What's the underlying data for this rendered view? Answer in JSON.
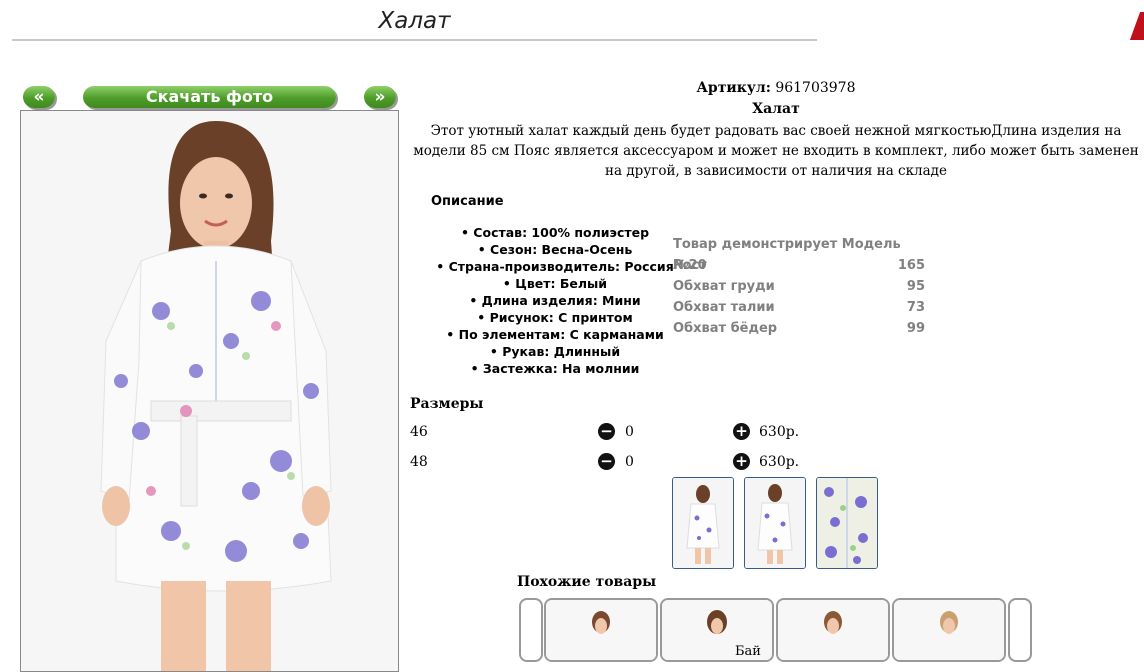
{
  "page": {
    "title": "Халат",
    "bottom_fragment": "Бай"
  },
  "nav": {
    "prev_label": "«",
    "download_label": "Скачать фото",
    "next_label": "»"
  },
  "product": {
    "article_label": "Артикул:",
    "article_value": "961703978",
    "name": "Халат",
    "description": "Этот уютный халат каждый день будет радовать вас своей нежной мягкостьюДлина изделия на модели 85 см Пояс является аксессуаром и может не входить в комплект, либо может быть заменен на другой, в зависимости от наличия на складе"
  },
  "description_heading": "Описание",
  "attributes": [
    "• Состав: 100% полиэстер",
    "• Сезон: Весна-Осень",
    "• Страна-производитель: Россия",
    "• Цвет: Белый",
    "• Длина изделия: Мини",
    "• Рисунок: С принтом",
    "• По элементам: С карманами",
    "• Рукав: Длинный",
    "• Застежка: На молнии"
  ],
  "model_info": {
    "title": "Товар демонстрирует Модель №20",
    "rows": [
      {
        "label": "Рост",
        "value": "165"
      },
      {
        "label": "Обхват груди",
        "value": "95"
      },
      {
        "label": "Обхват талии",
        "value": "73"
      },
      {
        "label": "Обхват бёдер",
        "value": "99"
      }
    ]
  },
  "sizes": {
    "heading": "Размеры",
    "rows": [
      {
        "size": "46",
        "minus_icon": "−",
        "qty": "0",
        "plus_icon": "+",
        "price": "630р."
      },
      {
        "size": "48",
        "minus_icon": "−",
        "qty": "0",
        "plus_icon": "+",
        "price": "630р."
      }
    ]
  },
  "similar": {
    "heading": "Похожие товары"
  },
  "colors": {
    "button_green": "#4e9d2a",
    "thumb_border": "#3a5a8a",
    "model_text": "#808080",
    "accent_red": "#c0101a"
  },
  "icons": {
    "minus": "minus-circle-icon",
    "plus": "plus-circle-icon"
  }
}
